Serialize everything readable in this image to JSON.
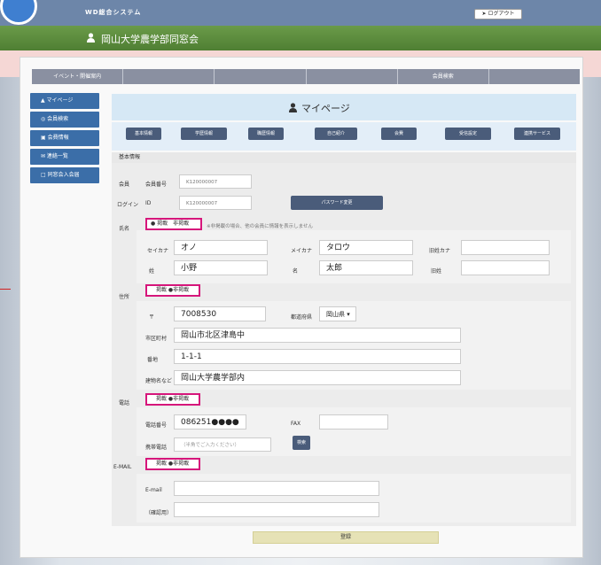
{
  "header": {
    "site_logo": "WD総合システム",
    "site_title": "岡山大学農学部同窓会",
    "logout_label": "➤ ログアウト"
  },
  "nav": {
    "items": [
      "イベント・開催案内",
      "",
      "",
      "",
      "会員検索",
      ""
    ]
  },
  "sidebar": {
    "items": [
      "▲ マイページ",
      "◎ 会員検索",
      "▣ 会費情報",
      "✉ 連絡一覧",
      "□ 同窓会入会届"
    ]
  },
  "main": {
    "title": "マイページ",
    "tabs": [
      "基本情報",
      "学歴情報",
      "職歴情報",
      "自己紹介",
      "会費",
      "受信設定",
      "連携サービス"
    ],
    "section_title": "基本情報"
  },
  "account": {
    "member_label": "会員",
    "member_no_label": "会員番号",
    "member_no": "K120000007",
    "login_label": "ログイン",
    "id_label": "ID",
    "login_id": "K120000007",
    "password_button": "パスワード変更"
  },
  "name": {
    "label": "氏名",
    "radio": "● 掲載　非掲載",
    "note": "※非掲載の場合、他の会員に情報を表示しません",
    "sei_kana_label": "セイカナ",
    "sei_kana": "オノ",
    "mei_kana_label": "メイカナ",
    "mei_kana": "タロウ",
    "old_kana_label": "旧姓カナ",
    "old_kana": "",
    "sei_label": "姓",
    "sei": "小野",
    "mei_label": "名",
    "mei": "太郎",
    "old_label": "旧姓",
    "old": ""
  },
  "address": {
    "label": "住所",
    "radio": "　掲載 ●非掲載",
    "zip_label": "〒",
    "zip": "7008530",
    "pref_label": "都道府県",
    "pref": "岡山県 ▾",
    "city_label": "市区町村",
    "city": "岡山市北区津島中",
    "street_label": "番地",
    "street": "1-1-1",
    "building_label": "建物名など",
    "building": "岡山大学農学部内"
  },
  "phone": {
    "label": "電話",
    "radio": "　掲載 ●非掲載",
    "tel_label": "電話番号",
    "tel": "086251●●●●",
    "fax_label": "FAX",
    "fax": "",
    "mobile_label": "携帯電話",
    "mobile_placeholder": "（半角でご入力ください）",
    "search_button": "検索"
  },
  "email": {
    "label": "E-MAIL",
    "radio": "　掲載 ●非掲載",
    "email_label": "E-mail",
    "email": "",
    "confirm_label": "（確認用）",
    "confirm": ""
  },
  "footer": {
    "save_button": "登録"
  }
}
